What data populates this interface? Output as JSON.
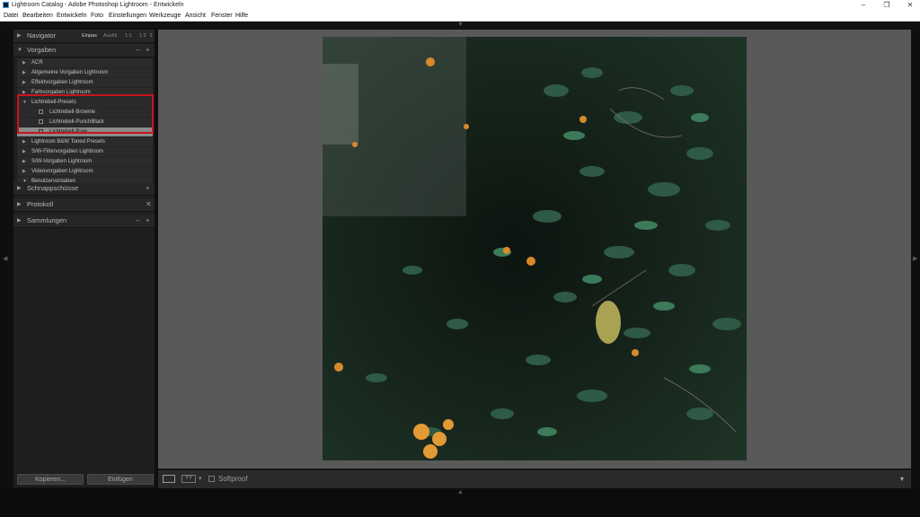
{
  "window": {
    "title": "Lightroom Catalog - Adobe Photoshop Lightroom - Entwickeln",
    "minimize": "–",
    "maximize": "❐",
    "close": "✕"
  },
  "menu": [
    "Datei",
    "Bearbeiten",
    "Entwickeln",
    "Foto",
    "Einstellungen",
    "Werkzeuge",
    "Ansicht",
    "Fenster",
    "Hilfe"
  ],
  "navigator": {
    "label": "Navigator",
    "zoom_options": [
      "Einpas",
      "Ausfül",
      "1:1",
      "1:2"
    ],
    "zoom_more": "⇕",
    "active_zoom": "Einpas"
  },
  "presets": {
    "label": "Vorgaben",
    "minus": "–",
    "plus": "+",
    "items": [
      {
        "label": "ACR",
        "type": "folder",
        "expanded": false
      },
      {
        "label": "Allgemeine Vorgaben Lightroom",
        "type": "folder",
        "expanded": false
      },
      {
        "label": "Effektvorgaben Lightroom",
        "type": "folder",
        "expanded": false
      },
      {
        "label": "Farbvorgaben Lightroom",
        "type": "folder",
        "expanded": false
      },
      {
        "label": "Lichtrebell-Presets",
        "type": "folder",
        "expanded": true
      },
      {
        "label": "Lichtrebell-Brownie",
        "type": "preset"
      },
      {
        "label": "Lichtrebell-PunchBlack",
        "type": "preset"
      },
      {
        "label": "Lichtrebell-Pure",
        "type": "preset",
        "selected": true
      },
      {
        "label": "Lightroom B&W Toned Presets",
        "type": "folder",
        "expanded": false
      },
      {
        "label": "S/W-Filtervorgaben Lightroom",
        "type": "folder",
        "expanded": false
      },
      {
        "label": "S/W-Vorgaben Lightroom",
        "type": "folder",
        "expanded": false
      },
      {
        "label": "Videovorgaben Lightroom",
        "type": "folder",
        "expanded": false
      },
      {
        "label": "Benutzervorgaben",
        "type": "folder",
        "expanded": true
      }
    ]
  },
  "snapshots": {
    "label": "Schnappschüsse",
    "plus": "+"
  },
  "history": {
    "label": "Protokoll",
    "close": "✕"
  },
  "collections": {
    "label": "Sammlungen",
    "minus": "–",
    "plus": "+"
  },
  "buttons": {
    "copy": "Kopieren...",
    "paste": "Einfügen"
  },
  "toolbar": {
    "softproof": "Softproof",
    "dropdown": "▾",
    "yy": "YY",
    "menu": "▾"
  },
  "colors": {
    "highlight_red": "#c8141e",
    "selected_preset_bg": "#8a8a8a"
  }
}
